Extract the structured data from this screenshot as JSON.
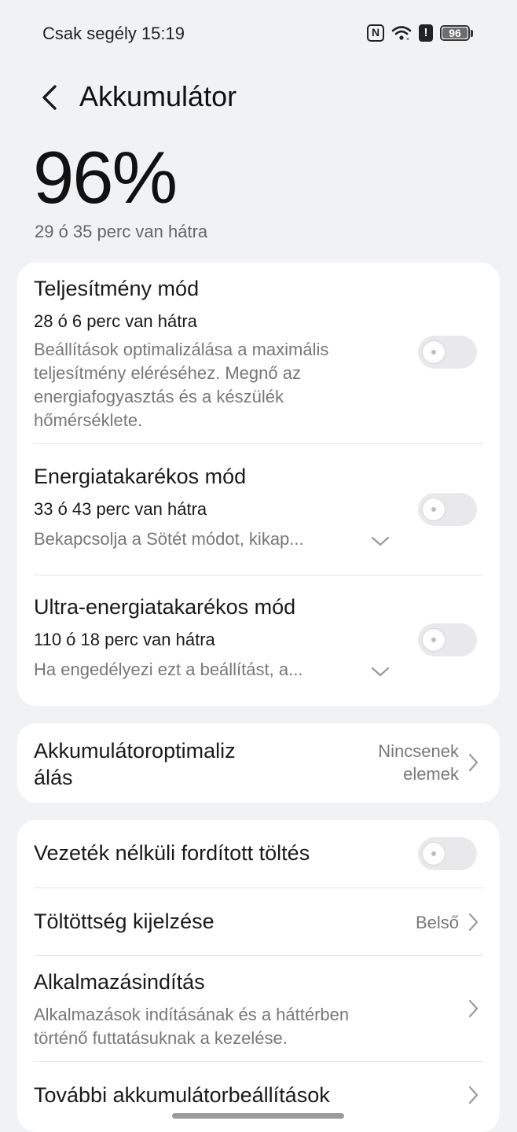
{
  "statusbar": {
    "carrier_time": "Csak segély 15:19",
    "nfc_icon": "nfc-icon",
    "wifi_icon": "wifi-icon",
    "alert_icon": "alert-icon",
    "battery_level": "96"
  },
  "header": {
    "back_icon": "chevron-left-icon",
    "title": "Akkumulátor"
  },
  "summary": {
    "percent": "96%",
    "remaining": "29 ó 35 perc van hátra"
  },
  "modes": [
    {
      "title": "Teljesítmény mód",
      "time": "28 ó 6 perc van hátra",
      "desc_lines": [
        "Beállítások optimalizálása a maximális",
        "teljesítmény eléréséhez. Megnő az",
        "energiafogyasztás és a készülék",
        "hőmérséklete."
      ],
      "enabled": false
    },
    {
      "title": "Energiatakarékos mód",
      "time": "33 ó 43 perc van hátra",
      "desc": "Bekapcsolja a Sötét módot, kikap...",
      "enabled": false
    },
    {
      "title": "Ultra-energiatakarékos mód",
      "time": "110 ó 18 perc van hátra",
      "desc": "Ha engedélyezi ezt a beállítást, a...",
      "enabled": false
    }
  ],
  "optimization": {
    "title_lines": [
      "Akkumulátoroptimaliz",
      "álás"
    ],
    "value_lines": [
      "Nincsenek",
      "elemek"
    ]
  },
  "settings": {
    "reverse_charging": {
      "title": "Vezeték nélküli fordított töltés",
      "enabled": false
    },
    "charge_display": {
      "title": "Töltöttség kijelzése",
      "value": "Belső"
    },
    "app_launch": {
      "title": "Alkalmazásindítás",
      "desc_lines": [
        "Alkalmazások indításának és a háttérben",
        "történő futtatásuknak a kezelése."
      ]
    },
    "more": {
      "title": "További akkumulátorbeállítások"
    }
  }
}
